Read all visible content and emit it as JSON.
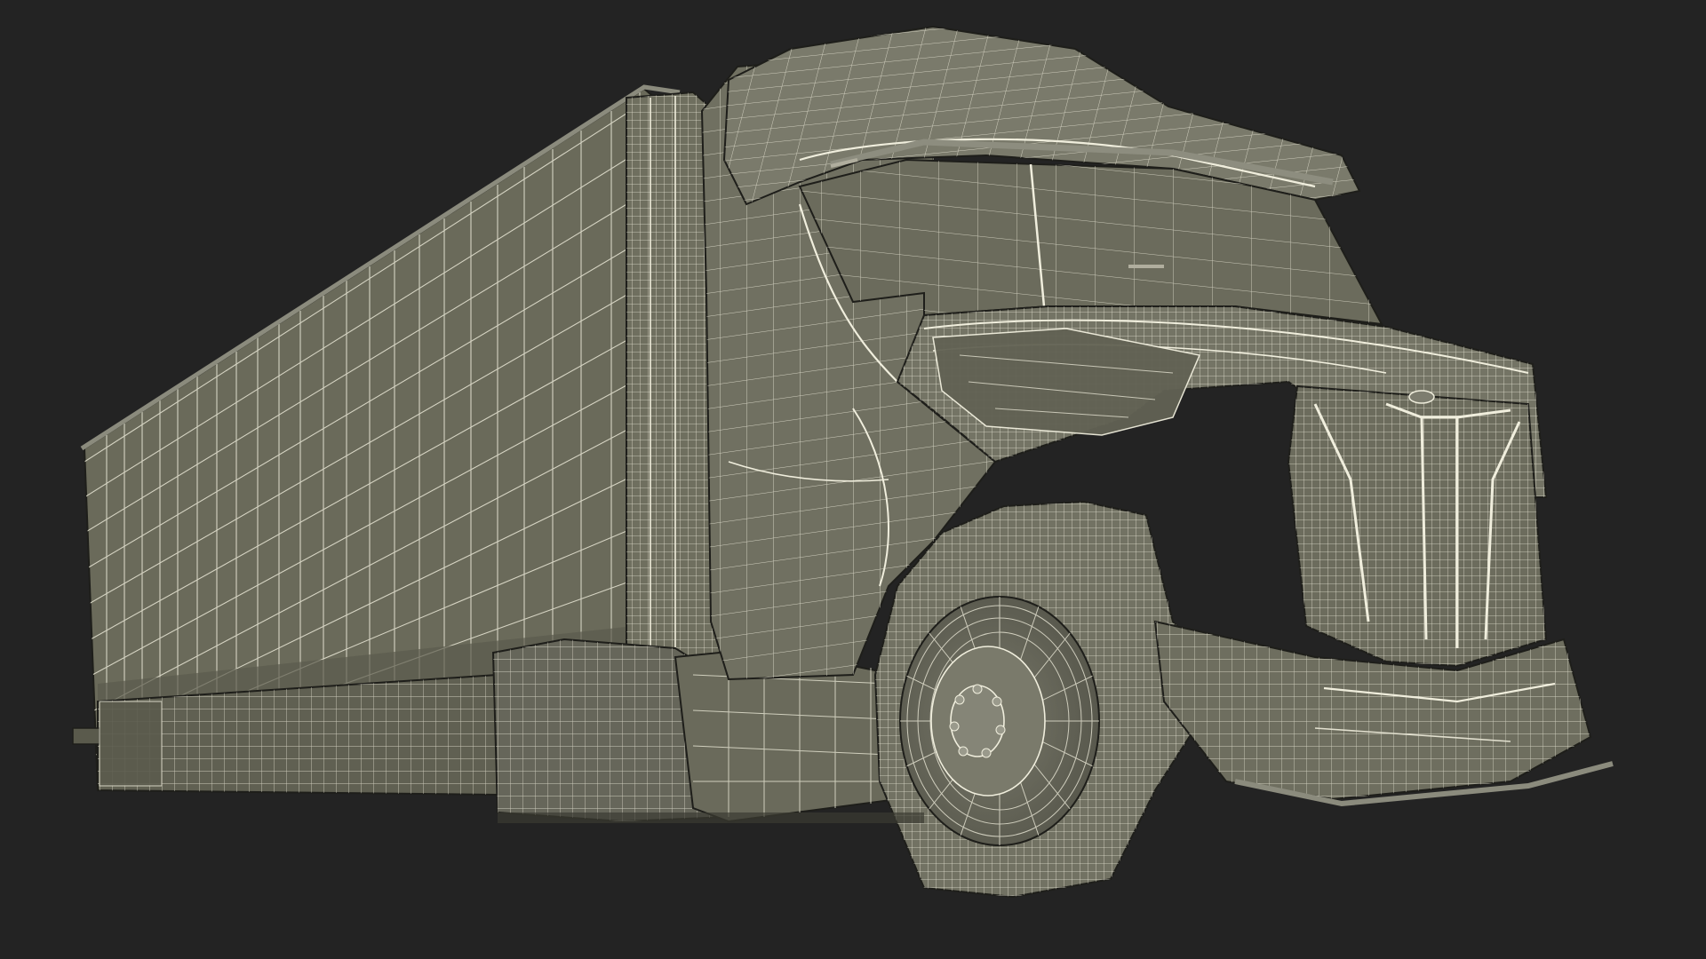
{
  "scene": {
    "background_color": "#232323",
    "surface_color": "#6e6e5e",
    "surface_shadow_color": "#4d4d42",
    "surface_highlight_color": "#85857a",
    "wire_color": "#e2e0cf",
    "wire_dense_color": "#f0eedd",
    "edge_color": "#1e1e1a"
  }
}
